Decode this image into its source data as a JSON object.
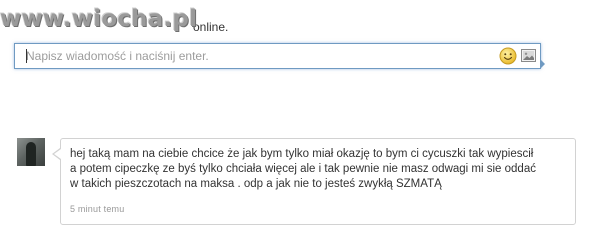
{
  "watermark": {
    "text": "www.wiocha.pl"
  },
  "header": {
    "status_text": "online."
  },
  "chat_input": {
    "placeholder": "Napisz wiadomość i naciśnij enter.",
    "value": ""
  },
  "toolbar": {
    "emoticon_icon": "smiley-icon",
    "image_icon": "image-icon"
  },
  "comment": {
    "lines": [
      "hej taką mam na ciebie chcice że jak bym tylko miał okazję to bym ci cycuszki tak wypiescił",
      "a potem cipeczkę ze byś tylko chciała więcej ale i tak pewnie nie masz odwagi mi sie oddać",
      "w takich pieszczotach na maksa . odp a jak nie to jesteś zwykłą SZMATĄ"
    ],
    "time": "5 minut temu"
  },
  "colors": {
    "input_border": "#6f9ac2",
    "bubble_border": "#d2d2d2",
    "text": "#333333",
    "muted": "#999999"
  }
}
